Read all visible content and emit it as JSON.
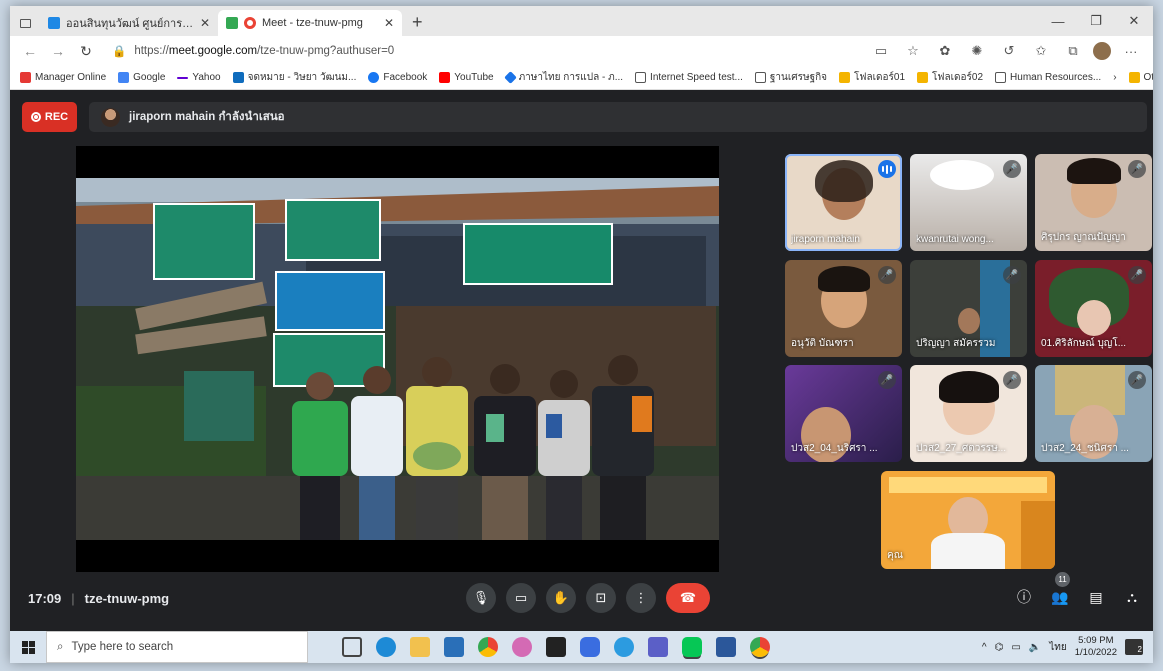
{
  "browser": {
    "tabs": [
      {
        "title": "ออนสินทุนวัฒน์ ศูนย์การเรียนรู้ชุมชนของ",
        "favicon_color": "#1e88e5",
        "active": false
      },
      {
        "title": "Meet - tze-tnuw-pmg",
        "favicon_color": "#ea4335",
        "active": true
      }
    ],
    "new_tab_icon": "plus-icon",
    "address": {
      "prefix": "https://",
      "host": "meet.google.com",
      "path": "/tze-tnuw-pmg?authuser=0"
    },
    "bookmarks": [
      {
        "label": "Manager Online",
        "color": "#e53935"
      },
      {
        "label": "Google",
        "color": "#4285f4"
      },
      {
        "label": "Yahoo",
        "color": "#6001d2"
      },
      {
        "label": "จดหมาย - วิษยา วัฒนม...",
        "color": "#0f6cbd"
      },
      {
        "label": "Facebook",
        "color": "#1877f2"
      },
      {
        "label": "YouTube",
        "color": "#ff0000"
      },
      {
        "label": "ภาษาไทย การแปล - ภ...",
        "color": "#1a73e8"
      },
      {
        "label": "Internet Speed test...",
        "color": "#555555"
      },
      {
        "label": "ฐานเศรษฐกิจ",
        "color": "#555555"
      },
      {
        "label": "โฟลเดอร์01",
        "color": "#f4b400"
      },
      {
        "label": "โฟลเดอร์02",
        "color": "#f4b400"
      },
      {
        "label": "Human Resources...",
        "color": "#555555"
      }
    ],
    "other_favorites": "Other favorites"
  },
  "meet": {
    "rec_label": "REC",
    "presenting_text": "jiraporn mahain กำลังนำเสนอ",
    "time": "17:09",
    "meeting_code": "tze-tnuw-pmg",
    "participant_count": "11",
    "participants": [
      {
        "name": "jiraporn mahain",
        "muted": false,
        "speaking": true
      },
      {
        "name": "kwanrutai wong...",
        "muted": true
      },
      {
        "name": "ศิรุปกร ญาณปัญญา",
        "muted": true
      },
      {
        "name": "อนุวัติ บัณฑรา",
        "muted": true
      },
      {
        "name": "ปริญญา สมัครรวม",
        "muted": true
      },
      {
        "name": "01.ศิริลักษณ์ บุญโ...",
        "muted": true
      },
      {
        "name": "ปวส2_04_นริศรา ...",
        "muted": true
      },
      {
        "name": "ปวส2_27_ศตวรรษ...",
        "muted": true
      },
      {
        "name": "ปวส2_24_ชนิศรา ...",
        "muted": true
      },
      {
        "name": "คุณ",
        "muted": false
      }
    ]
  },
  "taskbar": {
    "search_placeholder": "Type here to search",
    "lang": "ไทย",
    "time": "5:09 PM",
    "date": "1/10/2022",
    "notifications": "2"
  }
}
